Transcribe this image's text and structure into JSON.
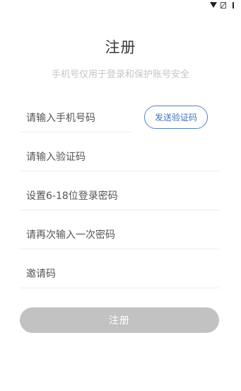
{
  "status_bar": {
    "icons": [
      "wifi-icon",
      "no-sim-icon",
      "battery-icon"
    ]
  },
  "page": {
    "title": "注册",
    "subtitle": "手机号仅用于登录和保护账号安全"
  },
  "form": {
    "phone_placeholder": "请输入手机号码",
    "send_code_label": "发送验证码",
    "code_placeholder": "请输入验证码",
    "password_placeholder": "设置6-18位登录密码",
    "confirm_password_placeholder": "请再次输入一次密码",
    "invite_placeholder": "邀请码",
    "submit_label": "注册"
  },
  "colors": {
    "accent": "#4f82c8",
    "submit_disabled": "#c2c2c2",
    "subtitle": "#c6c6c6"
  }
}
